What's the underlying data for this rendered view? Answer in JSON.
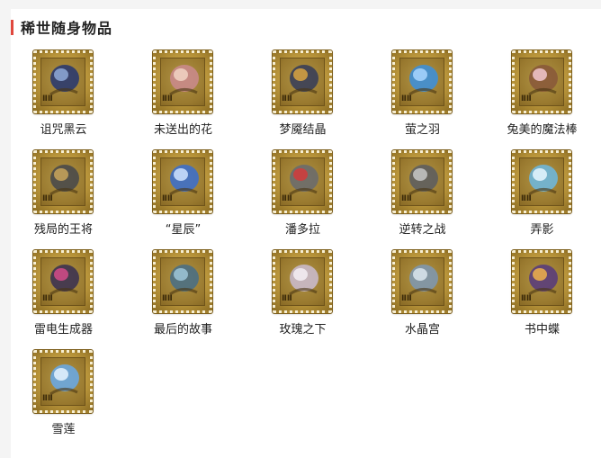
{
  "section": {
    "title": "稀世随身物品",
    "accent_color": "#e0483e"
  },
  "items": [
    {
      "label": "诅咒黑云",
      "icon": "cursed-cloud-icon"
    },
    {
      "label": "未送出的花",
      "icon": "flower-bouquet-icon"
    },
    {
      "label": "梦魇结晶",
      "icon": "nightmare-crystal-icon"
    },
    {
      "label": "萤之羽",
      "icon": "firefly-wings-icon"
    },
    {
      "label": "兔美的魔法棒",
      "icon": "magic-wand-icon"
    },
    {
      "label": "残局的王将",
      "icon": "chess-king-icon"
    },
    {
      "label": "“星辰”",
      "icon": "star-bottle-icon"
    },
    {
      "label": "潘多拉",
      "icon": "pandora-box-icon"
    },
    {
      "label": "逆转之战",
      "icon": "knight-helmet-icon"
    },
    {
      "label": "弄影",
      "icon": "shadow-glass-icon"
    },
    {
      "label": "雷电生成器",
      "icon": "thunder-generator-icon"
    },
    {
      "label": "最后的故事",
      "icon": "last-story-book-icon"
    },
    {
      "label": "玫瑰之下",
      "icon": "rose-letter-icon"
    },
    {
      "label": "水晶宫",
      "icon": "crystal-palace-icon"
    },
    {
      "label": "书中蝶",
      "icon": "book-butterfly-icon"
    },
    {
      "label": "雪莲",
      "icon": "snow-lotus-icon"
    }
  ],
  "stamp_mark": "ⅡⅡ"
}
